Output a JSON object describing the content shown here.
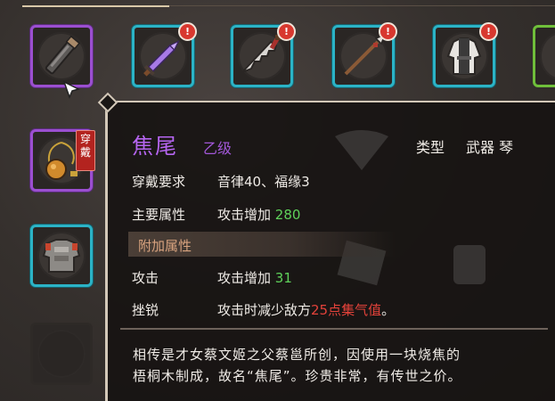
{
  "inventory": {
    "slots_row1": [
      {
        "icon": "brush-staff-icon",
        "rarity": "purple",
        "alert": false
      },
      {
        "icon": "purple-sword-icon",
        "rarity": "cyan",
        "alert": true
      },
      {
        "icon": "serrated-blade-icon",
        "rarity": "cyan",
        "alert": true
      },
      {
        "icon": "spear-icon",
        "rarity": "cyan",
        "alert": true
      },
      {
        "icon": "robe-armor-icon",
        "rarity": "cyan",
        "alert": true
      },
      {
        "icon": "partial-item-icon",
        "rarity": "green",
        "alert": false
      }
    ],
    "alert_mark": "!",
    "equipped_tag": "穿戴",
    "slot_row2_icon": "gourd-necklace-icon",
    "slot_row3_icon": "chest-armor-icon"
  },
  "tooltip": {
    "name": "焦尾",
    "grade": "乙级",
    "type_label": "类型",
    "type_value": "武器 琴",
    "requirement_label": "穿戴要求",
    "requirement_value": "音律40、福缘3",
    "main_attr_label": "主要属性",
    "main_attr_text": "攻击增加",
    "main_attr_value": "280",
    "extra_header": "附加属性",
    "attack_label": "攻击",
    "attack_text": "攻击增加",
    "attack_value": "31",
    "frustrate_label": "挫锐",
    "frustrate_text": "攻击时减少敌方",
    "frustrate_value": "25点集气值",
    "frustrate_suffix": "。",
    "description_line1": "相传是才女蔡文姬之父蔡邕所创，因使用一块烧焦的",
    "description_line2": "梧桐木制成，故名“焦尾”。珍贵非常，有传世之价。"
  },
  "colors": {
    "purple": "#9b4fd0",
    "cyan": "#2bb3c6",
    "green": "#6fbf3a",
    "alert_red": "#d8382f"
  }
}
